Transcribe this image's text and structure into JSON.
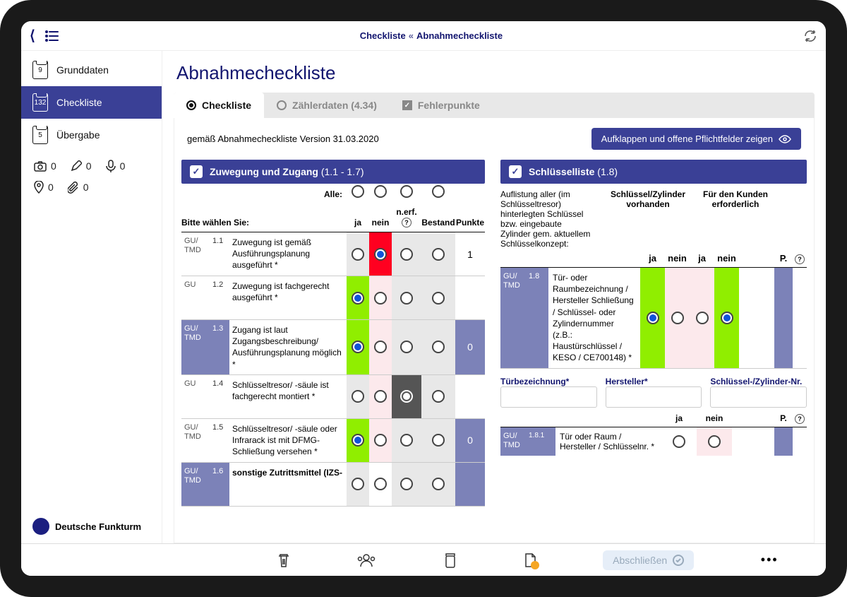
{
  "breadcrumb": {
    "a": "Checkliste",
    "b": "Abnahmecheckliste"
  },
  "sidebar": {
    "items": [
      {
        "badge": "9",
        "label": "Grunddaten"
      },
      {
        "badge": "132",
        "label": "Checkliste"
      },
      {
        "badge": "5",
        "label": "Übergabe"
      }
    ],
    "tools": {
      "camera": "0",
      "pen": "0",
      "mic": "0",
      "pin": "0",
      "clip": "0"
    },
    "brand": "Deutsche Funkturm"
  },
  "page": {
    "title": "Abnahmecheckliste",
    "tabs": {
      "checkliste": "Checkliste",
      "zaehler": "Zählerdaten (4.34)",
      "fehler": "Fehlerpunkte"
    },
    "version_note": "gemäß Abnahmecheckliste Version 31.03.2020",
    "expand_btn": "Aufklappen und offene Pflichtfelder zeigen"
  },
  "sectionA": {
    "title": "Zuwegung und Zugang",
    "range": "(1.1 - 1.7)",
    "alle": "Alle:",
    "bitte": "Bitte wählen Sie:",
    "cols": {
      "ja": "ja",
      "nein": "nein",
      "nerf": "n.erf.",
      "bestand": "Bestand",
      "punkte": "Punkte"
    },
    "rows": [
      {
        "tag": "GU/\nTMD",
        "num": "1.1",
        "hl": false,
        "txt": "Zuwegung ist gemäß Ausführungsplanung ausgeführt *",
        "sel": "nein",
        "pts": "1",
        "pts_hl": false
      },
      {
        "tag": "GU",
        "num": "1.2",
        "hl": false,
        "txt": "Zuwegung ist fachgerecht ausgeführt *",
        "sel": "ja",
        "pts": "",
        "pts_hl": false
      },
      {
        "tag": "GU/\nTMD",
        "num": "1.3",
        "hl": true,
        "txt": "Zugang ist laut Zugangsbeschreibung/ Ausführungsplanung möglich *",
        "sel": "ja",
        "pts": "0",
        "pts_hl": true
      },
      {
        "tag": "GU",
        "num": "1.4",
        "hl": false,
        "txt": "Schlüsseltresor/ -säule ist fachgerecht montiert *",
        "sel": "nerf",
        "pts": "",
        "pts_hl": false
      },
      {
        "tag": "GU/\nTMD",
        "num": "1.5",
        "hl": false,
        "txt": "Schlüsseltresor/ -säule oder Infrarack ist mit DFMG-Schließung versehen *",
        "sel": "ja",
        "pts": "0",
        "pts_hl": true
      },
      {
        "tag": "GU/\nTMD",
        "num": "1.6",
        "hl": true,
        "txt": "sonstige Zutrittsmittel (IZS-",
        "sel": "",
        "pts": "",
        "pts_hl": true,
        "bold": true
      }
    ]
  },
  "sectionB": {
    "title": "Schlüsselliste",
    "range": "(1.8)",
    "desc": "Auflistung aller (im Schlüsseltresor) hinterlegten Schlüssel bzw. eingebaute Zylinder gem. aktuellem Schlüsselkonzept:",
    "h1": "Schlüssel/Zylinder vorhanden",
    "h2": "Für den Kunden erforderlich",
    "sub": {
      "ja": "ja",
      "nein": "nein",
      "ja2": "ja",
      "nein2": "nein",
      "p": "P."
    },
    "row1": {
      "tag": "GU/\nTMD",
      "num": "1.8",
      "txt": "Tür- oder Raumbezeichnung / Hersteller Schließung / Schlüssel- oder Zylindernummer (z.B.: Haustürschlüssel / KESO / CE700148) *"
    },
    "fields": {
      "f1": "Türbezeichnung*",
      "f2": "Hersteller*",
      "f3": "Schlüssel-/Zylinder-Nr."
    },
    "sub2": {
      "ja": "ja",
      "nein": "nein",
      "p": "P."
    },
    "row2": {
      "tag": "GU/\nTMD",
      "num": "1.8.1",
      "txt": "Tür oder Raum / Hersteller / Schlüsselnr. *"
    }
  },
  "bottom": {
    "finish": "Abschließen"
  }
}
